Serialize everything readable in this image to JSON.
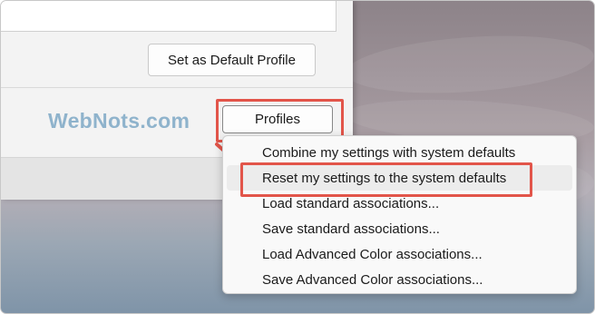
{
  "dialog": {
    "set_default_label": "Set as Default Profile",
    "profiles_label": "Profiles"
  },
  "watermark": "WebNots.com",
  "menu": {
    "items": [
      {
        "label": "Combine my settings with system defaults"
      },
      {
        "label": "Reset my settings to the system defaults"
      },
      {
        "label": "Load standard associations..."
      },
      {
        "label": "Save standard associations..."
      },
      {
        "label": "Load Advanced Color associations..."
      },
      {
        "label": "Save Advanced Color associations..."
      }
    ]
  },
  "colors": {
    "highlight": "#e2554a",
    "watermark": "#8fb3cc"
  }
}
